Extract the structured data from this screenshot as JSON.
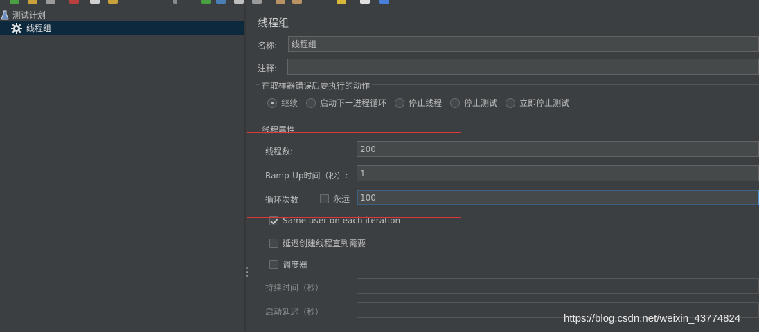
{
  "tree": {
    "root_label": "测试计划",
    "child_label": "线程组"
  },
  "panel": {
    "title": "线程组",
    "name_label": "名称:",
    "name_value": "线程组",
    "comment_label": "注释:",
    "comment_value": "",
    "error_action": {
      "title": "在取样器错误后要执行的动作",
      "options": [
        "继续",
        "启动下一进程循环",
        "停止线程",
        "停止测试",
        "立即停止测试"
      ],
      "selected": "继续"
    },
    "thread_props": {
      "title": "线程属性",
      "threads_label": "线程数:",
      "threads_value": "200",
      "rampup_label": "Ramp-Up时间（秒）:",
      "rampup_value": "1",
      "loop_label": "循环次数",
      "forever_label": "永远",
      "forever_checked": false,
      "loop_value": "100",
      "same_user_label": "Same user on each iteration",
      "same_user_checked": true,
      "delay_label": "延迟创建线程直到需要",
      "delay_checked": false,
      "scheduler_label": "调度器",
      "scheduler_checked": false,
      "duration_label": "持续时间（秒）",
      "duration_value": "",
      "startup_delay_label": "启动延迟（秒）",
      "startup_delay_value": ""
    }
  },
  "watermark": "https://blog.csdn.net/weixin_43774824",
  "colors": {
    "background": "#3c3f41",
    "selection": "#0d293e",
    "field_bg": "#45494a",
    "focus_border": "#4a88c7",
    "highlight_red": "#d9373a"
  }
}
